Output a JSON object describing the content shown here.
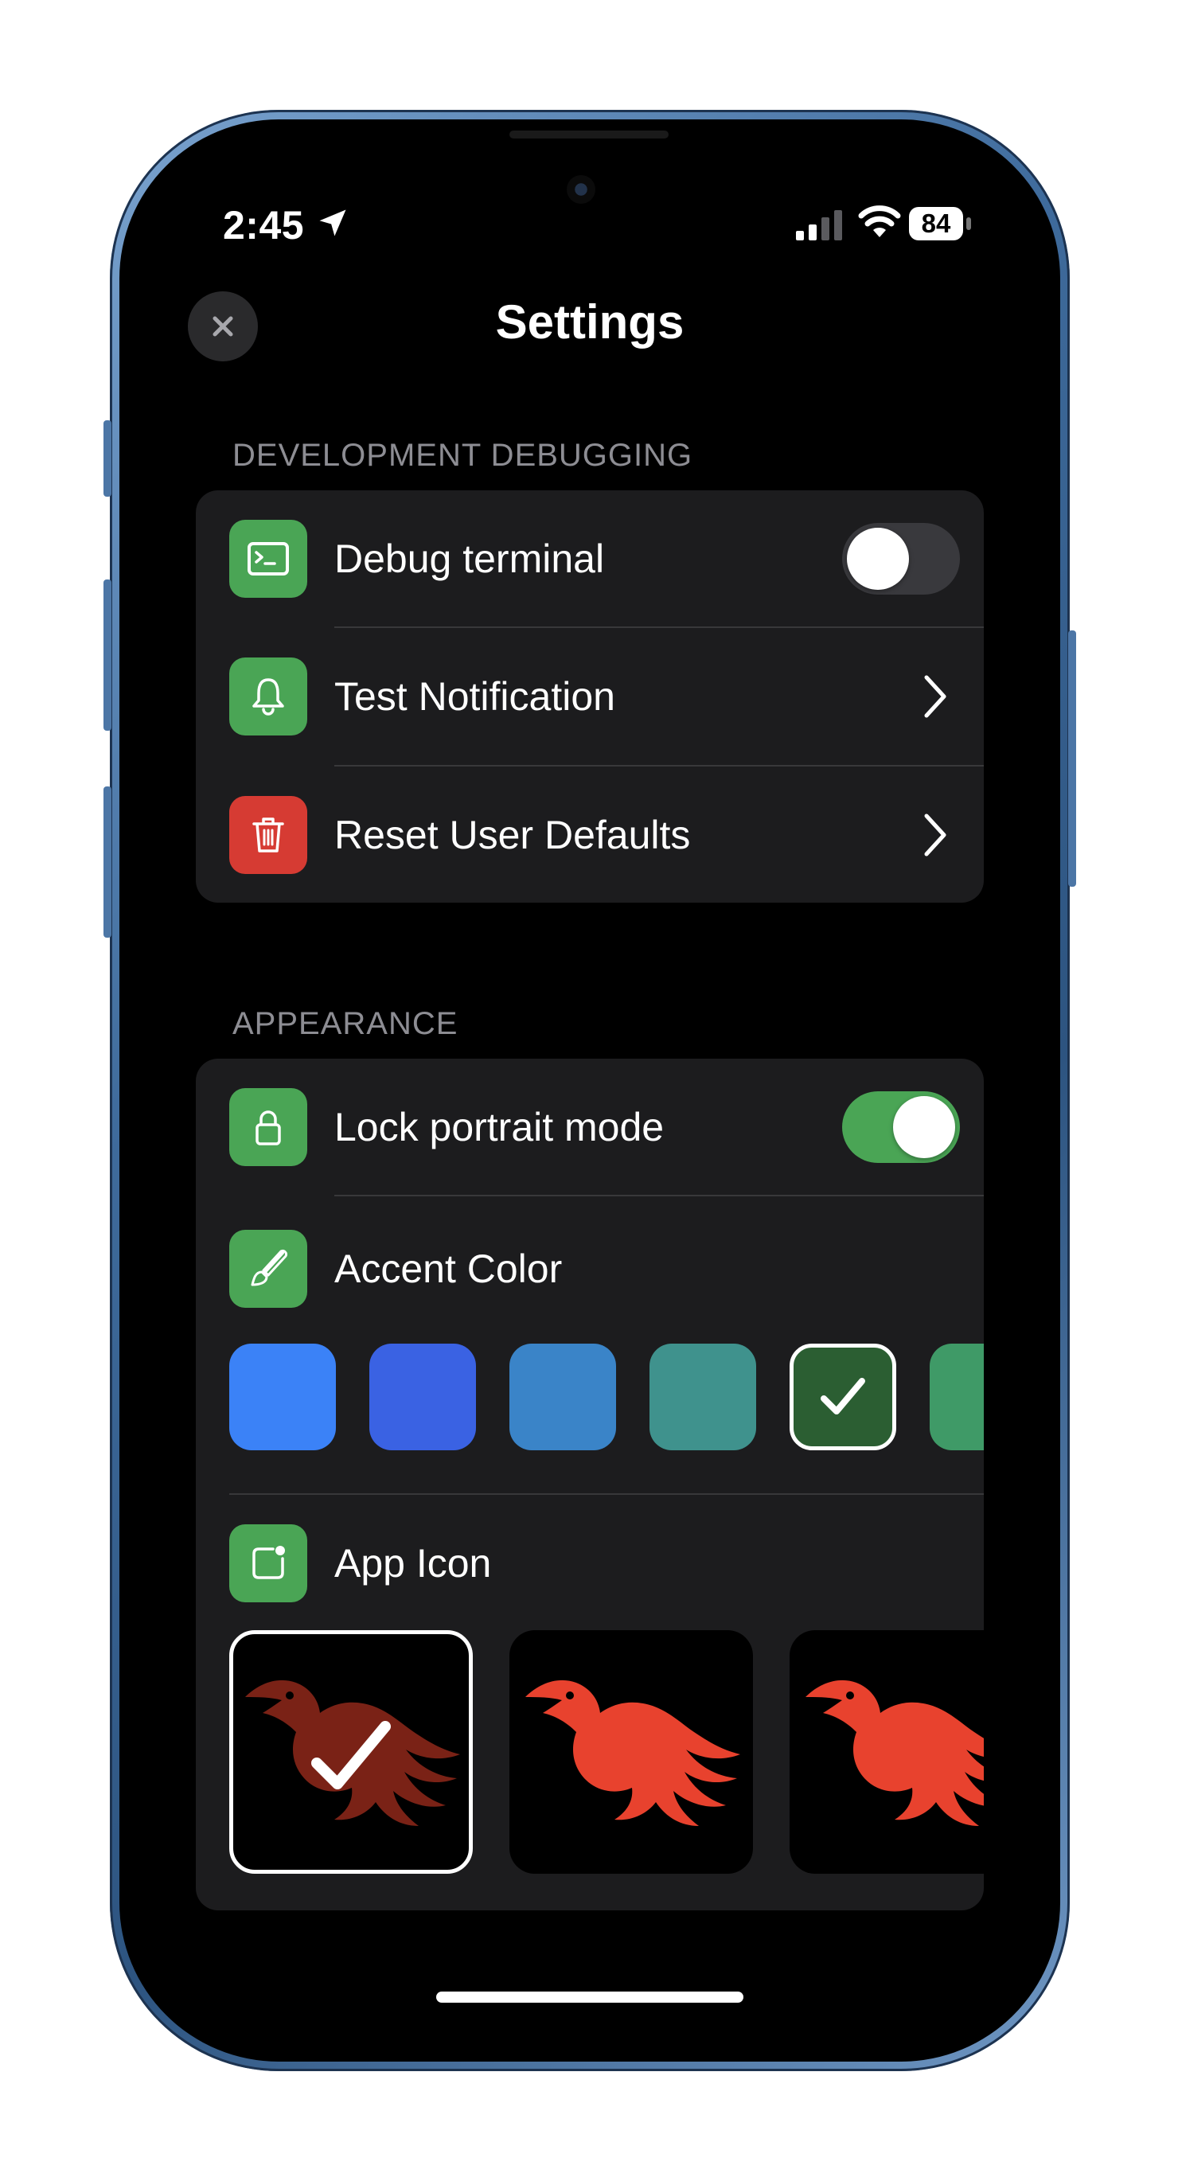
{
  "status_bar": {
    "time": "2:45",
    "battery": "84"
  },
  "nav": {
    "title": "Settings"
  },
  "development": {
    "header": "DEVELOPMENT DEBUGGING",
    "debug_terminal": {
      "label": "Debug terminal",
      "enabled": false
    },
    "test_notification": {
      "label": "Test Notification"
    },
    "reset_defaults": {
      "label": "Reset User Defaults"
    }
  },
  "appearance": {
    "header": "APPEARANCE",
    "lock_portrait": {
      "label": "Lock portrait mode",
      "enabled": true
    },
    "accent_color": {
      "label": "Accent Color",
      "swatches": [
        "#3b82f7",
        "#3a62e3",
        "#3a84c8",
        "#3f928d",
        "#2b5e32",
        "#3f9a67"
      ],
      "selected_index": 4
    },
    "app_icon": {
      "label": "App Icon",
      "options": [
        "dark-red-phoenix",
        "red-phoenix",
        "red-phoenix-alt"
      ],
      "selected_index": 0
    }
  },
  "colors": {
    "accent_green": "#4aa555",
    "destructive_red": "#d63b33",
    "card_bg": "#1c1c1e",
    "phoenix_red": "#e8422e",
    "phoenix_dark": "#7a2216"
  }
}
